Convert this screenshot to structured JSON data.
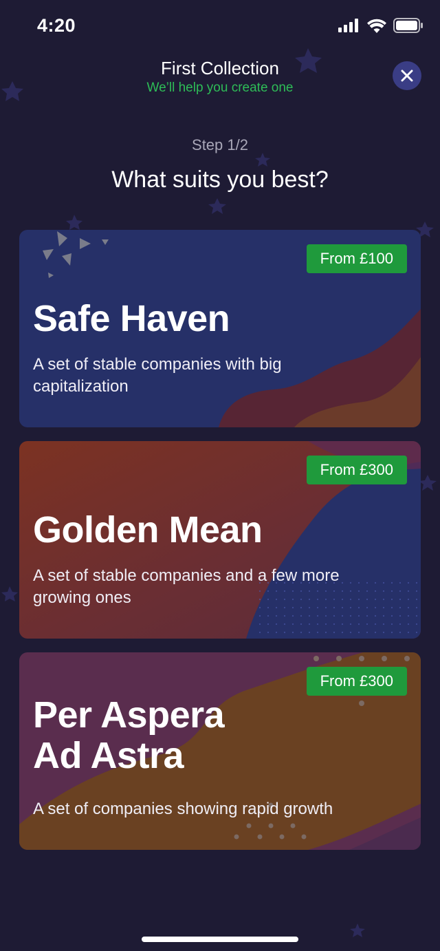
{
  "status_bar": {
    "time": "4:20"
  },
  "header": {
    "title": "First Collection",
    "subtitle": "We’ll help you create one"
  },
  "step": {
    "label": "Step 1/2"
  },
  "question": "What suits you best?",
  "cards": [
    {
      "badge": "From £100",
      "title_lines": [
        "Safe Haven"
      ],
      "description_lines": [
        "A set of stable companies with big",
        "capitalization"
      ]
    },
    {
      "badge": "From £300",
      "title_lines": [
        "Golden Mean"
      ],
      "description_lines": [
        "A set of stable companies and a few more",
        "growing ones"
      ]
    },
    {
      "badge": "From £300",
      "title_lines": [
        "Per Aspera",
        "Ad Astra"
      ],
      "description_lines": [
        "A set of companies showing rapid growth"
      ]
    }
  ],
  "colors": {
    "background": "#1e1b34",
    "accent_green": "#2ebd57",
    "badge_green": "#1f9a3c",
    "close_button": "#3a3d85",
    "card_blue": "#262f6a",
    "card_rust": "#7a3422",
    "card_plum": "#5b2d4f"
  },
  "icons": {
    "signal": "signal-icon",
    "wifi": "wifi-icon",
    "battery": "battery-icon",
    "close": "close-icon"
  }
}
